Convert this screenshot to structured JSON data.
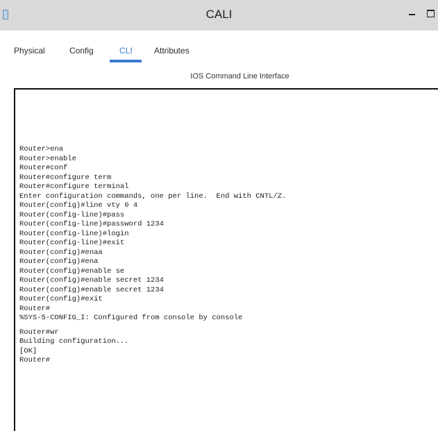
{
  "window": {
    "title": "CALI",
    "icons": {
      "app": "app-window-icon",
      "minimize": "minimize-icon",
      "maximize": "maximize-icon"
    }
  },
  "tabs": [
    {
      "label": "Physical"
    },
    {
      "label": "Config"
    },
    {
      "label": "CLI"
    },
    {
      "label": "Attributes"
    }
  ],
  "active_tab": "CLI",
  "accent_color": "#3a7bd5",
  "panel": {
    "heading": "IOS Command Line Interface"
  },
  "console": {
    "lines": [
      "Router>ena",
      "Router>enable",
      "Router#conf",
      "Router#configure term",
      "Router#configure terminal",
      "Enter configuration commands, one per line.  End with CNTL/Z.",
      "Router(config)#line vty 0 4",
      "Router(config-line)#pass",
      "Router(config-line)#password 1234",
      "Router(config-line)#login",
      "Router(config-line)#exit",
      "Router(config)#enaa",
      "Router(config)#ena",
      "Router(config)#enable se",
      "Router(config)#enable secret 1234",
      "Router(config)#enable secret 1234",
      "Router(config)#exit",
      "Router#",
      "%SYS-5-CONFIG_I: Configured from console by console",
      "",
      "Router#wr",
      "Building configuration...",
      "[OK]",
      "Router#"
    ]
  }
}
